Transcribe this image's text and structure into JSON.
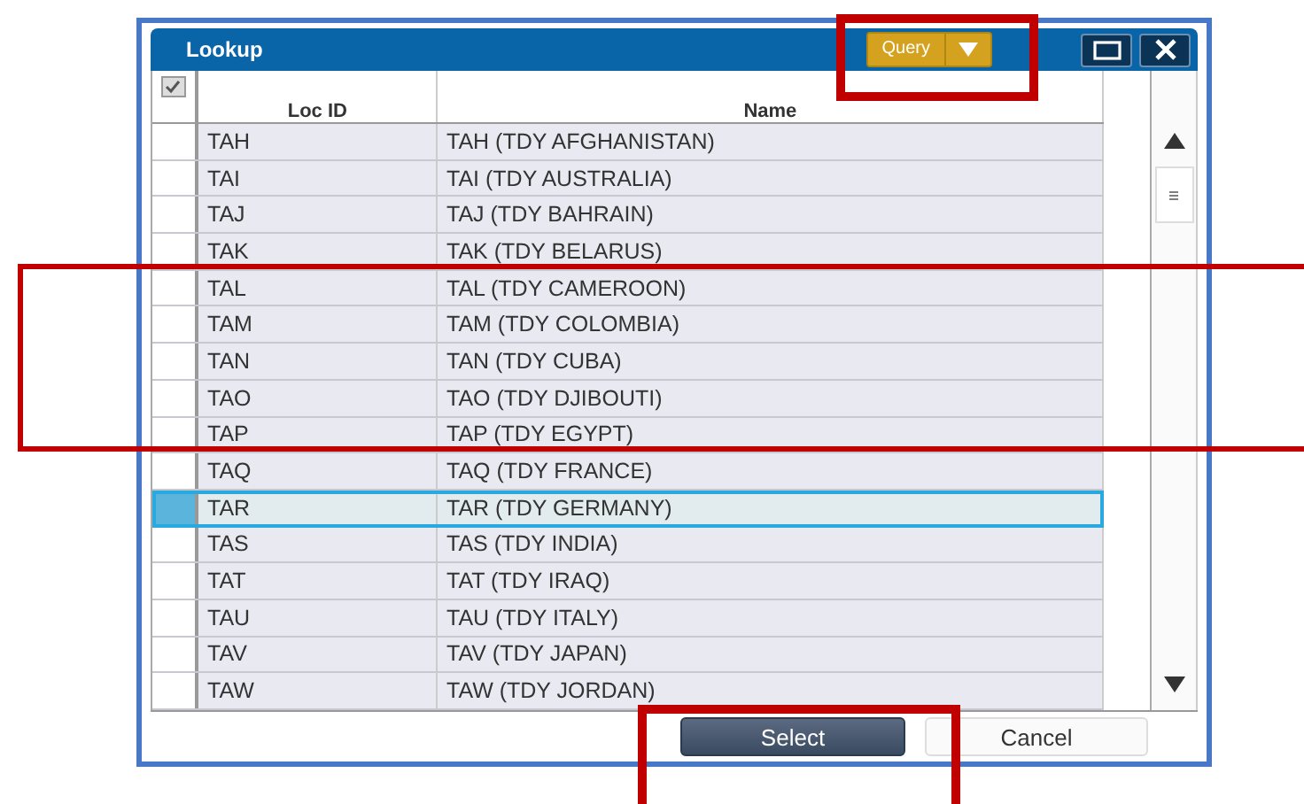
{
  "window": {
    "title": "Lookup"
  },
  "query_button": {
    "label": "Query"
  },
  "table": {
    "columns": [
      "Loc ID",
      "Name"
    ],
    "select_all_checked": true,
    "rows": [
      {
        "loc_id": "TAH",
        "name": "TAH (TDY AFGHANISTAN)",
        "selected": false
      },
      {
        "loc_id": "TAI",
        "name": "TAI (TDY AUSTRALIA)",
        "selected": false
      },
      {
        "loc_id": "TAJ",
        "name": "TAJ (TDY BAHRAIN)",
        "selected": false
      },
      {
        "loc_id": "TAK",
        "name": "TAK (TDY BELARUS)",
        "selected": false
      },
      {
        "loc_id": "TAL",
        "name": "TAL (TDY CAMEROON)",
        "selected": false
      },
      {
        "loc_id": "TAM",
        "name": "TAM (TDY COLOMBIA)",
        "selected": false
      },
      {
        "loc_id": "TAN",
        "name": "TAN (TDY CUBA)",
        "selected": false
      },
      {
        "loc_id": "TAO",
        "name": "TAO (TDY DJIBOUTI)",
        "selected": false
      },
      {
        "loc_id": "TAP",
        "name": "TAP (TDY EGYPT)",
        "selected": false
      },
      {
        "loc_id": "TAQ",
        "name": "TAQ (TDY FRANCE)",
        "selected": false
      },
      {
        "loc_id": "TAR",
        "name": "TAR (TDY GERMANY)",
        "selected": true
      },
      {
        "loc_id": "TAS",
        "name": "TAS (TDY INDIA)",
        "selected": false
      },
      {
        "loc_id": "TAT",
        "name": "TAT (TDY IRAQ)",
        "selected": false
      },
      {
        "loc_id": "TAU",
        "name": "TAU (TDY ITALY)",
        "selected": false
      },
      {
        "loc_id": "TAV",
        "name": "TAV (TDY JAPAN)",
        "selected": false
      },
      {
        "loc_id": "TAW",
        "name": "TAW (TDY JORDAN)",
        "selected": false
      }
    ]
  },
  "buttons": [
    {
      "label": "Select",
      "kind": "primary"
    },
    {
      "label": "Cancel",
      "kind": "secondary"
    }
  ]
}
